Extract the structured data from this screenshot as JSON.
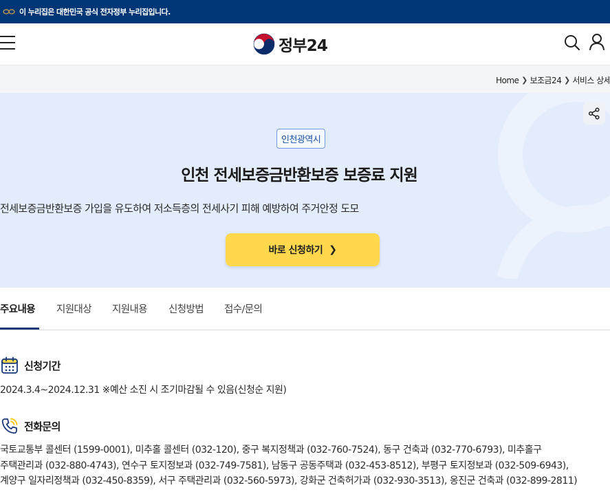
{
  "gov_banner": {
    "text": "이 누리집은 대한민국 공식 전자정부 누리집입니다."
  },
  "header": {
    "logo_text": "정부24"
  },
  "breadcrumb": [
    "Home",
    "보조금24",
    "서비스 상세"
  ],
  "hero": {
    "region": "인천광역시",
    "title": "인천 전세보증금반환보증 보증료 지원",
    "description": "전세보증금반환보증 가입을 유도하여 저소득층의 전세사기 피해 예방하여 주거안정 도모",
    "apply_label": "바로 신청하기"
  },
  "tabs": [
    "주요내용",
    "지원대상",
    "지원내용",
    "신청방법",
    "접수/문의"
  ],
  "sections": {
    "period": {
      "heading": "신청기간",
      "text": "2024.3.4~2024.12.31 ※예산 소진 시 조기마감될 수 있음(신청순 지원)"
    },
    "contact": {
      "heading": "전화문의",
      "lines": [
        "국토교통부 콜센터 (1599-0001), 미추홀 콜센터 (032-120), 중구 복지정책과 (032-760-7524), 동구 건축과 (032-770-6793), 미추홀구",
        "주택관리과 (032-880-4743), 연수구 토지정보과 (032-749-7581), 남동구 공동주택과 (032-453-8512), 부평구 토지정보과 (032-509-6943),",
        "계양구 일자리정책과 (032-450-8359), 서구 주택관리과 (032-560-5973), 강화군 건축허가과 (032-930-3513), 옹진군 건축과 (032-899-2811)"
      ]
    }
  },
  "colors": {
    "banner_bg": "#003675",
    "hero_bg": "#e2ecfb",
    "apply_button": "#ffd84e",
    "tab_active_underline": "#1a3a7a"
  },
  "icons": {
    "banner": "taegeuk-mark-icon",
    "menu": "hamburger-menu-icon",
    "search": "search-icon",
    "user": "user-icon",
    "share": "share-icon",
    "period": "calendar-icon",
    "contact": "phone-icon"
  }
}
